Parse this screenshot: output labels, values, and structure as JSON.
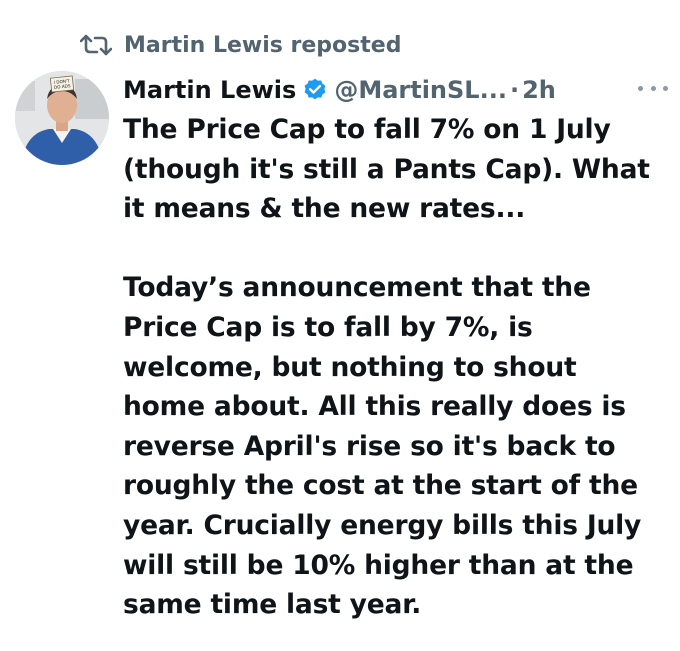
{
  "repost": {
    "icon": "repost-icon",
    "label": "Martin Lewis reposted"
  },
  "author": {
    "display_name": "Martin Lewis",
    "verified_icon": "verified-badge-icon",
    "handle": "@MartinSL...",
    "separator": "·",
    "time": "2h",
    "avatar_sign_text": "I DON'T DO ADS"
  },
  "tweet": {
    "paragraph_1": "The Price Cap to fall 7% on 1 July\n(though it's still a Pants Cap). What\nit means & the new rates...",
    "paragraph_2": "Today’s announcement that the\nPrice Cap is to fall by 7%, is\nwelcome, but nothing to shout\nhome about. All this really does is\nreverse April's rise so it's back to\nroughly the cost at the start of the\nyear. Crucially energy bills this July\nwill still be 10% higher than at the\nsame time last year."
  },
  "colors": {
    "text": "#0f1419",
    "secondary": "#536471",
    "verified": "#1d9bf0"
  }
}
